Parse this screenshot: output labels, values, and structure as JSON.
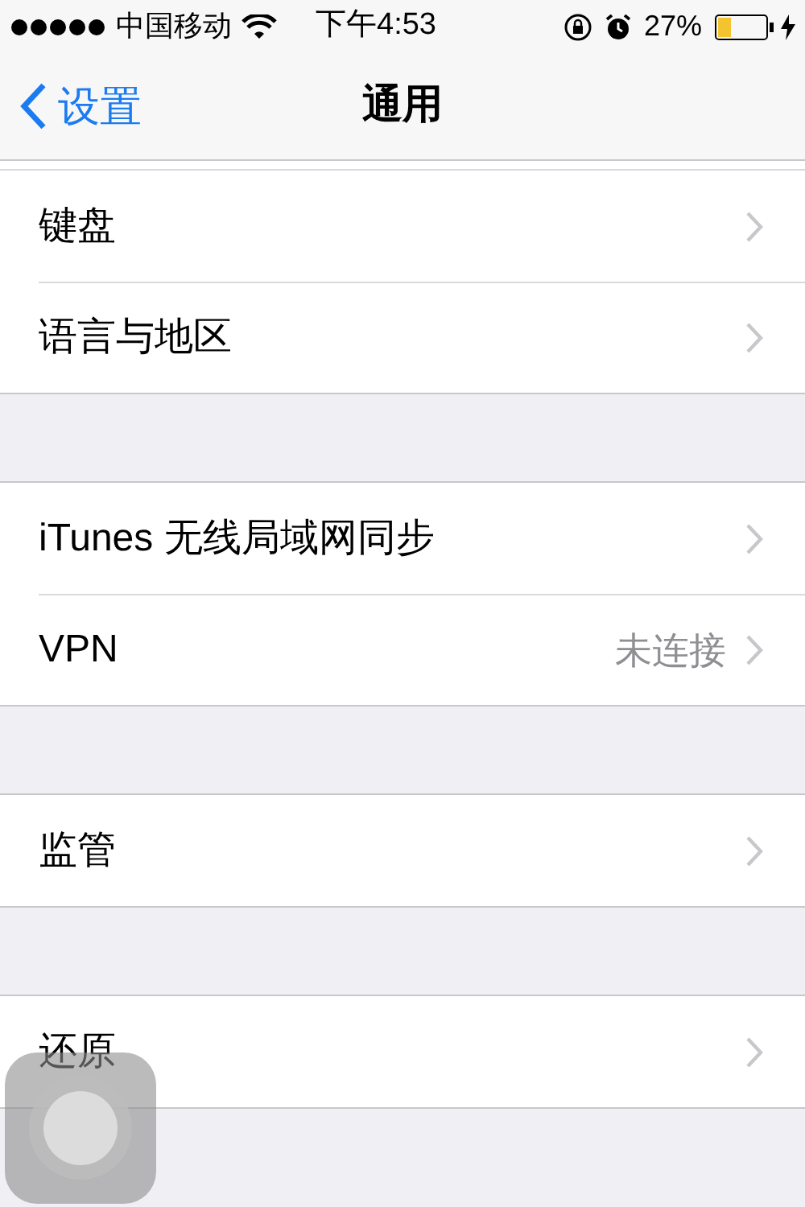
{
  "status_bar": {
    "carrier": "中国移动",
    "time": "下午4:53",
    "battery": "27%"
  },
  "nav": {
    "back": "设置",
    "title": "通用"
  },
  "groups": [
    {
      "rows": [
        {
          "label": "键盘"
        },
        {
          "label": "语言与地区"
        }
      ]
    },
    {
      "rows": [
        {
          "label": "iTunes 无线局域网同步"
        },
        {
          "label": "VPN",
          "value": "未连接"
        }
      ]
    },
    {
      "rows": [
        {
          "label": "监管"
        }
      ]
    },
    {
      "rows": [
        {
          "label": "还原"
        }
      ]
    }
  ]
}
